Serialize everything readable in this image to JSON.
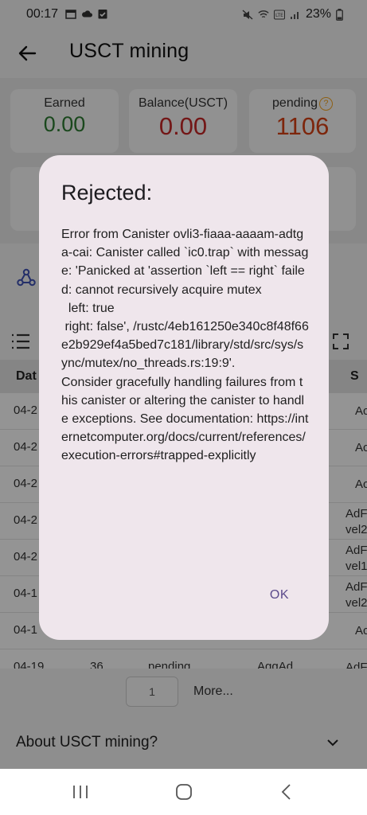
{
  "status_bar": {
    "time": "00:17",
    "battery": "23%"
  },
  "app_bar": {
    "title": "USCT mining"
  },
  "stats": {
    "earned_label": "Earned",
    "earned_value": "0.00",
    "balance_label": "Balance(USCT)",
    "balance_value": "0.00",
    "pending_label": "pending",
    "pending_value": "1106"
  },
  "table": {
    "header_date": "Dat",
    "header_s": "S",
    "rows": [
      {
        "date": "04-2",
        "src": "Ac"
      },
      {
        "date": "04-2",
        "src": "Ac"
      },
      {
        "date": "04-2",
        "src": "Ac"
      },
      {
        "date": "04-2",
        "src_line1": "AdF",
        "src_line2": "vel2"
      },
      {
        "date": "04-2",
        "src_line1": "AdF",
        "src_line2": "vel1"
      },
      {
        "date": "04-1",
        "src_line1": "AdF",
        "src_line2": "vel2"
      },
      {
        "date": "04-1",
        "src": "Ac"
      },
      {
        "date": "04-19",
        "amount": "36",
        "status": "pending",
        "type": "AggAd",
        "src": "AdF"
      }
    ]
  },
  "pager": {
    "page": "1",
    "more": "More..."
  },
  "about": {
    "label": "About USCT mining?"
  },
  "dialog": {
    "title": "Rejected:",
    "body": "Error from Canister ovli3-fiaaa-aaaam-adtga-cai: Canister called `ic0.trap` with message: 'Panicked at 'assertion `left == right` failed: cannot recursively acquire mutex\n  left: true\n right: false', /rustc/4eb161250e340c8f48f66e2b929ef4a5bed7c181/library/std/src/sys/sync/mutex/no_threads.rs:19:9'.\nConsider gracefully handling failures from this canister or altering the canister to handle exceptions. See documentation: https://internetcomputer.org/docs/current/references/execution-errors#trapped-explicitly",
    "ok_label": "OK"
  },
  "colors": {
    "earned": "#2e7d32",
    "balance": "#c62828",
    "pending": "#d84315",
    "dialog_bg": "#efe6ec",
    "dialog_action": "#5b4a8b"
  }
}
